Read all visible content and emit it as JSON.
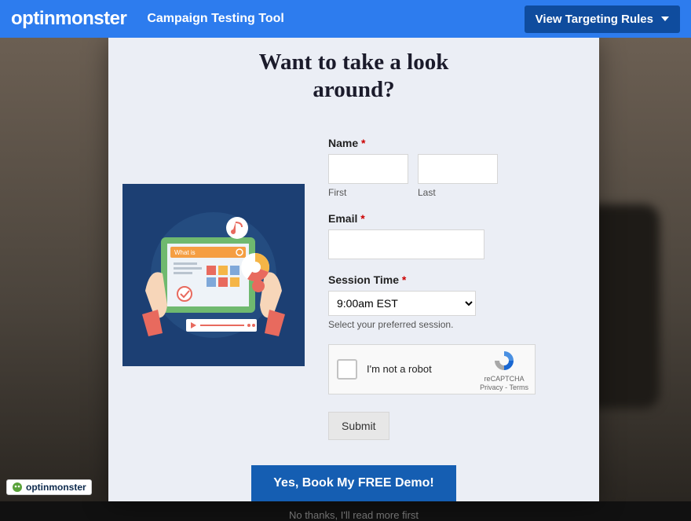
{
  "topbar": {
    "brand": "optinmonster",
    "tool": "Campaign Testing Tool",
    "dropdown": "View Targeting Rules"
  },
  "modal": {
    "headline_l1": "Want to take a look",
    "headline_l2": "around?",
    "name_label": "Name",
    "first": "First",
    "last": "Last",
    "email_label": "Email",
    "session_label": "Session Time",
    "session_options": [
      "9:00am EST"
    ],
    "session_selected": "9:00am EST",
    "session_help": "Select your preferred session.",
    "recaptcha_text": "I'm not a robot",
    "recaptcha_caption": "reCAPTCHA",
    "recaptcha_links": "Privacy - Terms",
    "submit": "Submit",
    "cta": "Yes, Book My FREE Demo!",
    "nothanks": "No thanks, I'll read more first"
  },
  "badge": "optinmonster"
}
